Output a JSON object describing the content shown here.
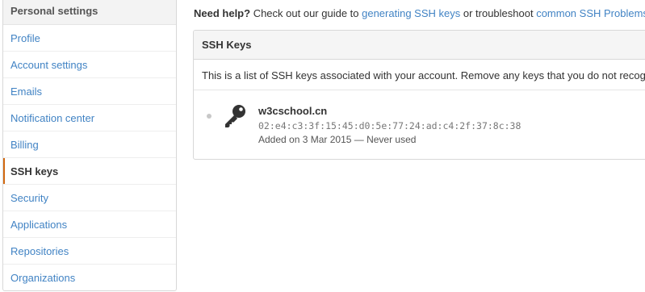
{
  "sidebar": {
    "header": "Personal settings",
    "items": [
      {
        "label": "Profile",
        "selected": false
      },
      {
        "label": "Account settings",
        "selected": false
      },
      {
        "label": "Emails",
        "selected": false
      },
      {
        "label": "Notification center",
        "selected": false
      },
      {
        "label": "Billing",
        "selected": false
      },
      {
        "label": "SSH keys",
        "selected": true
      },
      {
        "label": "Security",
        "selected": false
      },
      {
        "label": "Applications",
        "selected": false
      },
      {
        "label": "Repositories",
        "selected": false
      },
      {
        "label": "Organizations",
        "selected": false
      }
    ]
  },
  "help": {
    "lead": "Need help?",
    "text1": " Check out our guide to ",
    "link1": "generating SSH keys",
    "text2": " or troubleshoot ",
    "link2": "common SSH Problems"
  },
  "ssh": {
    "title": "SSH Keys",
    "description": "This is a list of SSH keys associated with your account. Remove any keys that you do not recognize.",
    "keys": [
      {
        "name": "w3cschool.cn",
        "fingerprint": "02:e4:c3:3f:15:45:d0:5e:77:24:ad:c4:2f:37:8c:38",
        "meta": "Added on 3 Mar 2015 — Never used",
        "icon": "key-icon",
        "status": "unused-dot"
      }
    ]
  },
  "colors": {
    "link": "#4183c4",
    "selected_accent": "#d26911",
    "header_bg": "#f3f3f3"
  }
}
